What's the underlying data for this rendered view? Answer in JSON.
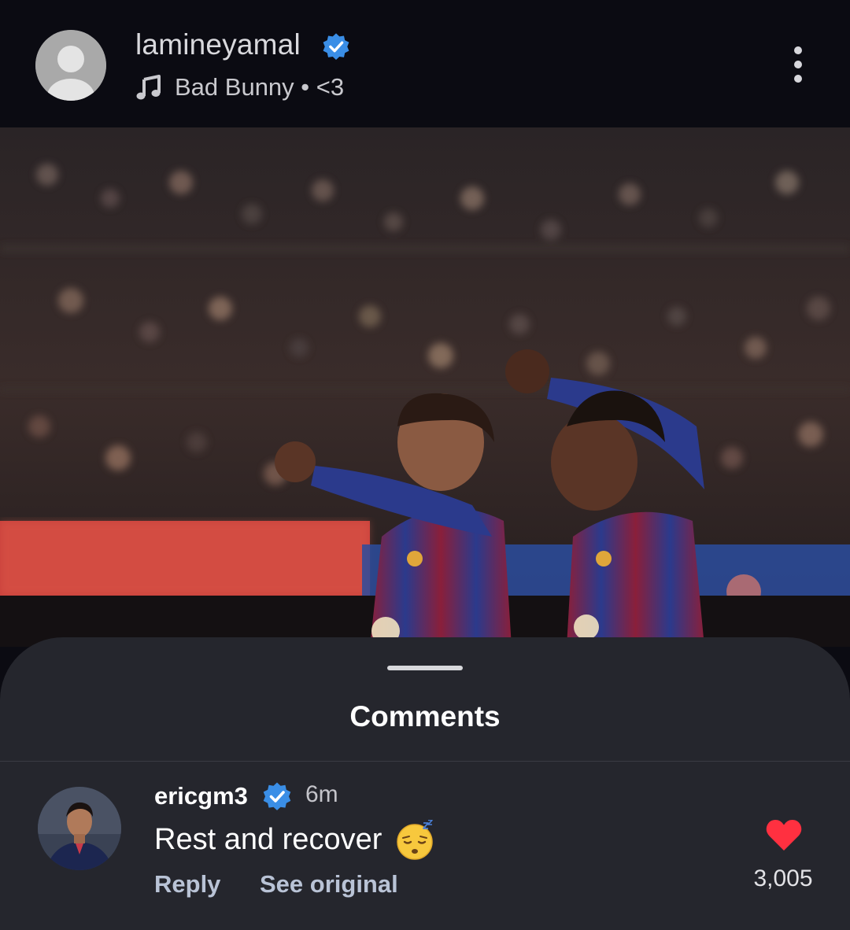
{
  "header": {
    "username": "lamineyamal",
    "verified_icon": "verified-badge-icon",
    "music_icon": "music-note-icon",
    "music_text": "Bad Bunny • <3",
    "menu_icon": "more-vertical-icon",
    "avatar_icon": "default-avatar-icon"
  },
  "post": {
    "image_icon": "photo"
  },
  "comments_sheet": {
    "title": "Comments",
    "comments": [
      {
        "username": "ericgm3",
        "verified": true,
        "time": "6m",
        "text": "Rest and recover",
        "emoji": "sleeping-face-emoji",
        "reply_label": "Reply",
        "see_original_label": "See original",
        "likes": "3,005",
        "like_icon": "heart-icon"
      }
    ]
  },
  "colors": {
    "background": "#0b0b12",
    "sheet": "#25262d",
    "verified_blue": "#3a8ee6",
    "heart_red": "#ff3040",
    "action_text": "#b9c3d6"
  }
}
